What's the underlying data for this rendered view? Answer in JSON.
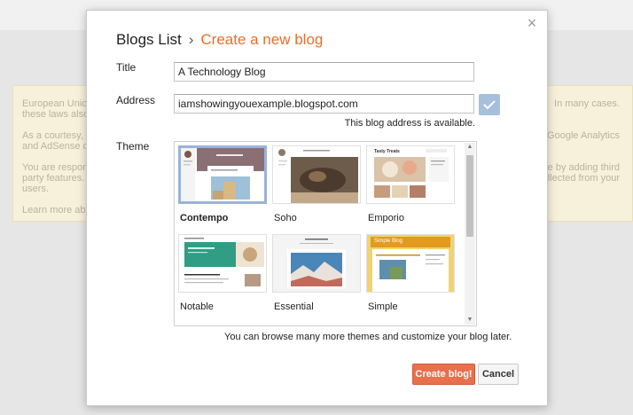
{
  "background": {
    "notice_left": [
      "European Unio",
      "these laws also",
      "As a courtesy, w",
      "and AdSense co",
      "You are respon",
      "party features. T",
      "users.",
      "Learn more abo"
    ],
    "notice_right": [
      "In many cases.",
      "of Google Analytics",
      "ample by adding third",
      "llected from your"
    ]
  },
  "dialog": {
    "close_glyph": "×",
    "breadcrumb_root": "Blogs List",
    "breadcrumb_sep": "›",
    "breadcrumb_current": "Create a new blog",
    "title_label": "Title",
    "title_value": "A Technology Blog",
    "address_label": "Address",
    "address_value": "iamshowingyouexample.blogspot.com",
    "address_status": "This blog address is available.",
    "theme_label": "Theme",
    "themes": [
      {
        "name": "Contempo",
        "selected": true
      },
      {
        "name": "Soho",
        "selected": false
      },
      {
        "name": "Emporio",
        "selected": false
      },
      {
        "name": "Notable",
        "selected": false
      },
      {
        "name": "Essential",
        "selected": false
      },
      {
        "name": "Simple",
        "selected": false
      }
    ],
    "thumb_text": {
      "emporio": "Tasty Treats",
      "simple": "Simple Blog"
    },
    "browse_note": "You can browse many more themes and customize your blog later.",
    "create_label": "Create blog!",
    "cancel_label": "Cancel"
  },
  "colors": {
    "accent": "#e8702a",
    "create_button": "#e8704d",
    "check_button": "#a6bfdc",
    "selected_border": "#9ab3d8"
  },
  "icons": [
    "close-icon",
    "checkmark-icon",
    "scroll-up-arrow-icon",
    "scroll-down-arrow-icon"
  ]
}
